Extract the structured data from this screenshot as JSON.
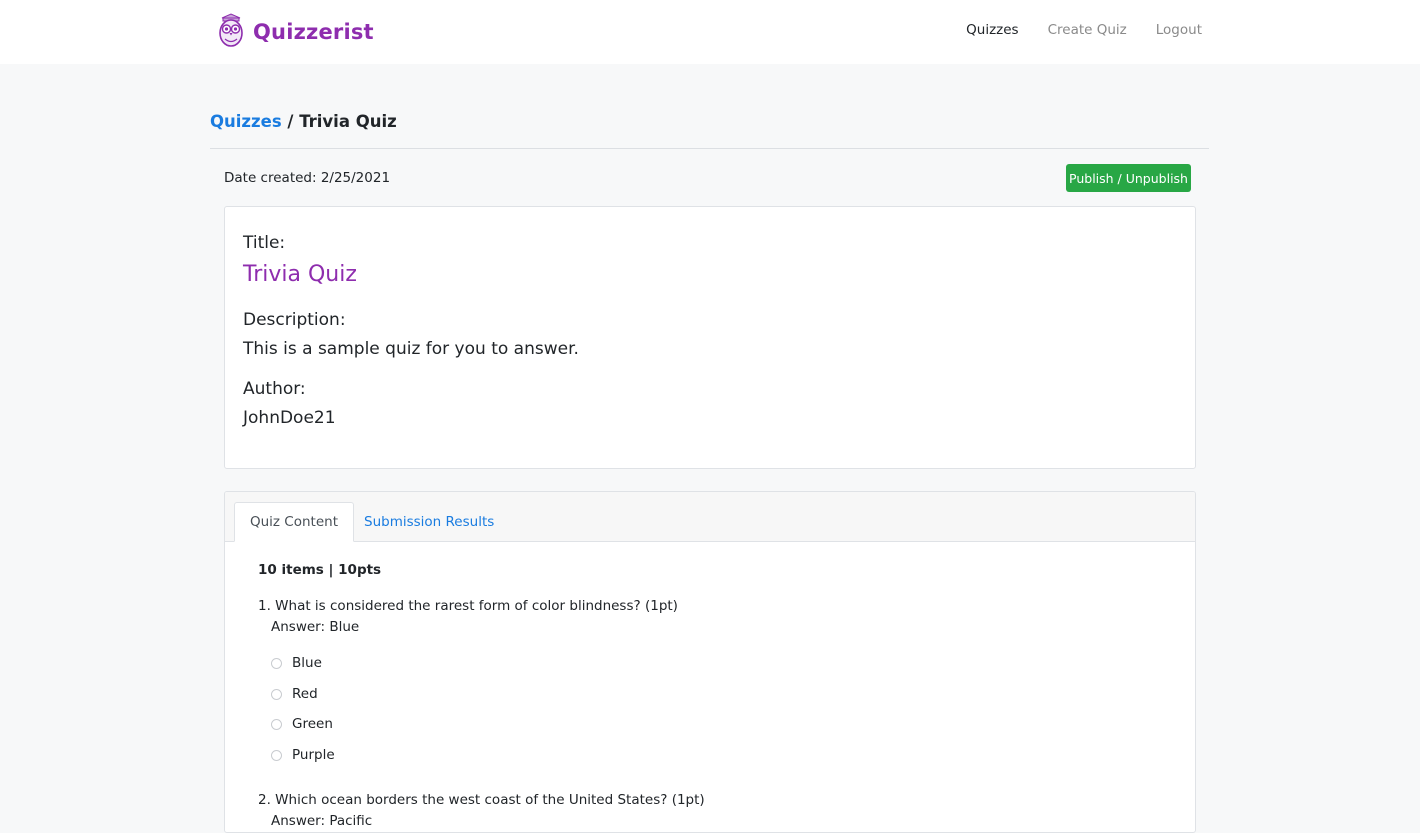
{
  "brand": {
    "name": "Quizzerist",
    "color": "#8e2dae",
    "logo_icon": "owl-logo-icon"
  },
  "nav": {
    "items": [
      {
        "label": "Quizzes",
        "active": true
      },
      {
        "label": "Create Quiz",
        "active": false
      },
      {
        "label": "Logout",
        "active": false
      }
    ]
  },
  "breadcrumb": {
    "root": "Quizzes",
    "separator": "/",
    "current": "Trivia Quiz"
  },
  "meta": {
    "date_created": "Date created: 2/25/2021"
  },
  "actions": {
    "publish_label": "Publish / Unpublish",
    "publish_color": "#28a745"
  },
  "info": {
    "title_label": "Title:",
    "title_value": "Trivia Quiz",
    "description_label": "Description:",
    "description_value": "This is a sample quiz for you to answer.",
    "author_label": "Author:",
    "author_value": "JohnDoe21"
  },
  "tabs": [
    {
      "label": "Quiz Content",
      "active": true
    },
    {
      "label": "Submission Results",
      "active": false
    }
  ],
  "quiz": {
    "summary": "10 items | 10pts",
    "questions": [
      {
        "text": "1. What is considered the rarest form of color blindness? (1pt)",
        "answer": "Answer: Blue",
        "options": [
          "Blue",
          "Red",
          "Green",
          "Purple"
        ]
      },
      {
        "text": "2. Which ocean borders the west coast of the United States? (1pt)",
        "answer": "Answer: Pacific"
      }
    ]
  }
}
